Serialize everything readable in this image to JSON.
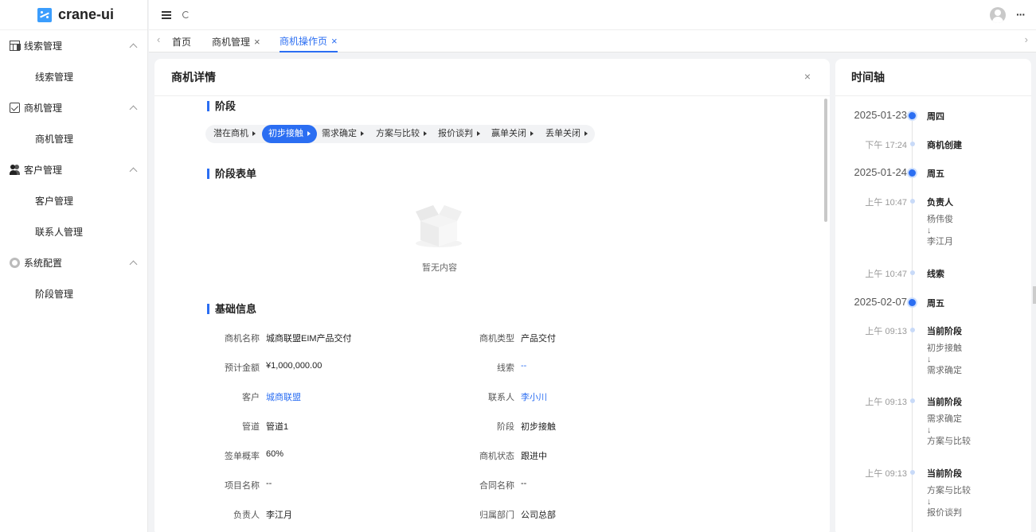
{
  "app": {
    "logo_text": "crane-ui"
  },
  "sidebar": {
    "groups": [
      {
        "label": "线索管理",
        "icon": "table-icon",
        "items": [
          "线索管理"
        ]
      },
      {
        "label": "商机管理",
        "icon": "checkbox-icon",
        "items": [
          "商机管理"
        ]
      },
      {
        "label": "客户管理",
        "icon": "users-icon",
        "items": [
          "客户管理",
          "联系人管理"
        ]
      },
      {
        "label": "系统配置",
        "icon": "gear-icon",
        "items": [
          "阶段管理"
        ]
      }
    ]
  },
  "topbar": {
    "more_label": "···"
  },
  "tabs": [
    {
      "label": "首页",
      "closable": false,
      "active": false
    },
    {
      "label": "商机管理",
      "closable": true,
      "active": false
    },
    {
      "label": "商机操作页",
      "closable": true,
      "active": true
    }
  ],
  "main": {
    "title": "商机详情",
    "close_label": "×",
    "stage_section": "阶段",
    "stages": [
      "潜在商机",
      "初步接触",
      "需求确定",
      "方案与比较",
      "报价谈判",
      "赢单关闭",
      "丢单关闭"
    ],
    "active_stage": "初步接触",
    "form_section": "阶段表单",
    "empty_text": "暂无内容",
    "basic_section": "基础信息",
    "fields_left": [
      {
        "label": "商机名称",
        "value": "城商联盟EIM产品交付",
        "link": false
      },
      {
        "label": "预计金额",
        "value": "¥1,000,000.00",
        "link": false
      },
      {
        "label": "客户",
        "value": "城商联盟",
        "link": true
      },
      {
        "label": "管道",
        "value": "管道1",
        "link": false
      },
      {
        "label": "签单概率",
        "value": "60%",
        "link": false
      },
      {
        "label": "项目名称",
        "value": "--",
        "link": false
      },
      {
        "label": "负责人",
        "value": "李江月",
        "link": false
      }
    ],
    "fields_right": [
      {
        "label": "商机类型",
        "value": "产品交付",
        "link": false
      },
      {
        "label": "线索",
        "value": "--",
        "link": true
      },
      {
        "label": "联系人",
        "value": "李小川",
        "link": true
      },
      {
        "label": "阶段",
        "value": "初步接触",
        "link": false
      },
      {
        "label": "商机状态",
        "value": "跟进中",
        "link": false
      },
      {
        "label": "合同名称",
        "value": "--",
        "link": false
      },
      {
        "label": "归属部门",
        "value": "公司总部",
        "link": false
      }
    ]
  },
  "timeline": {
    "title": "时间轴",
    "entries": [
      {
        "kind": "date",
        "left": "2025-01-23",
        "right": "周四"
      },
      {
        "kind": "event",
        "left": "下午 17:24",
        "title": "商机创建",
        "lines": []
      },
      {
        "kind": "date",
        "left": "2025-01-24",
        "right": "周五"
      },
      {
        "kind": "event",
        "left": "上午 10:47",
        "title": "负责人",
        "lines": [
          "杨伟俊",
          "↓",
          "李江月"
        ]
      },
      {
        "kind": "event",
        "left": "上午 10:47",
        "title": "线索",
        "lines": []
      },
      {
        "kind": "date",
        "left": "2025-02-07",
        "right": "周五"
      },
      {
        "kind": "event",
        "left": "上午 09:13",
        "title": "当前阶段",
        "lines": [
          "初步接触",
          "↓",
          "需求确定"
        ]
      },
      {
        "kind": "event",
        "left": "上午 09:13",
        "title": "当前阶段",
        "lines": [
          "需求确定",
          "↓",
          "方案与比较"
        ]
      },
      {
        "kind": "event",
        "left": "上午 09:13",
        "title": "当前阶段",
        "lines": [
          "方案与比较",
          "↓",
          "报价谈判"
        ]
      }
    ]
  }
}
